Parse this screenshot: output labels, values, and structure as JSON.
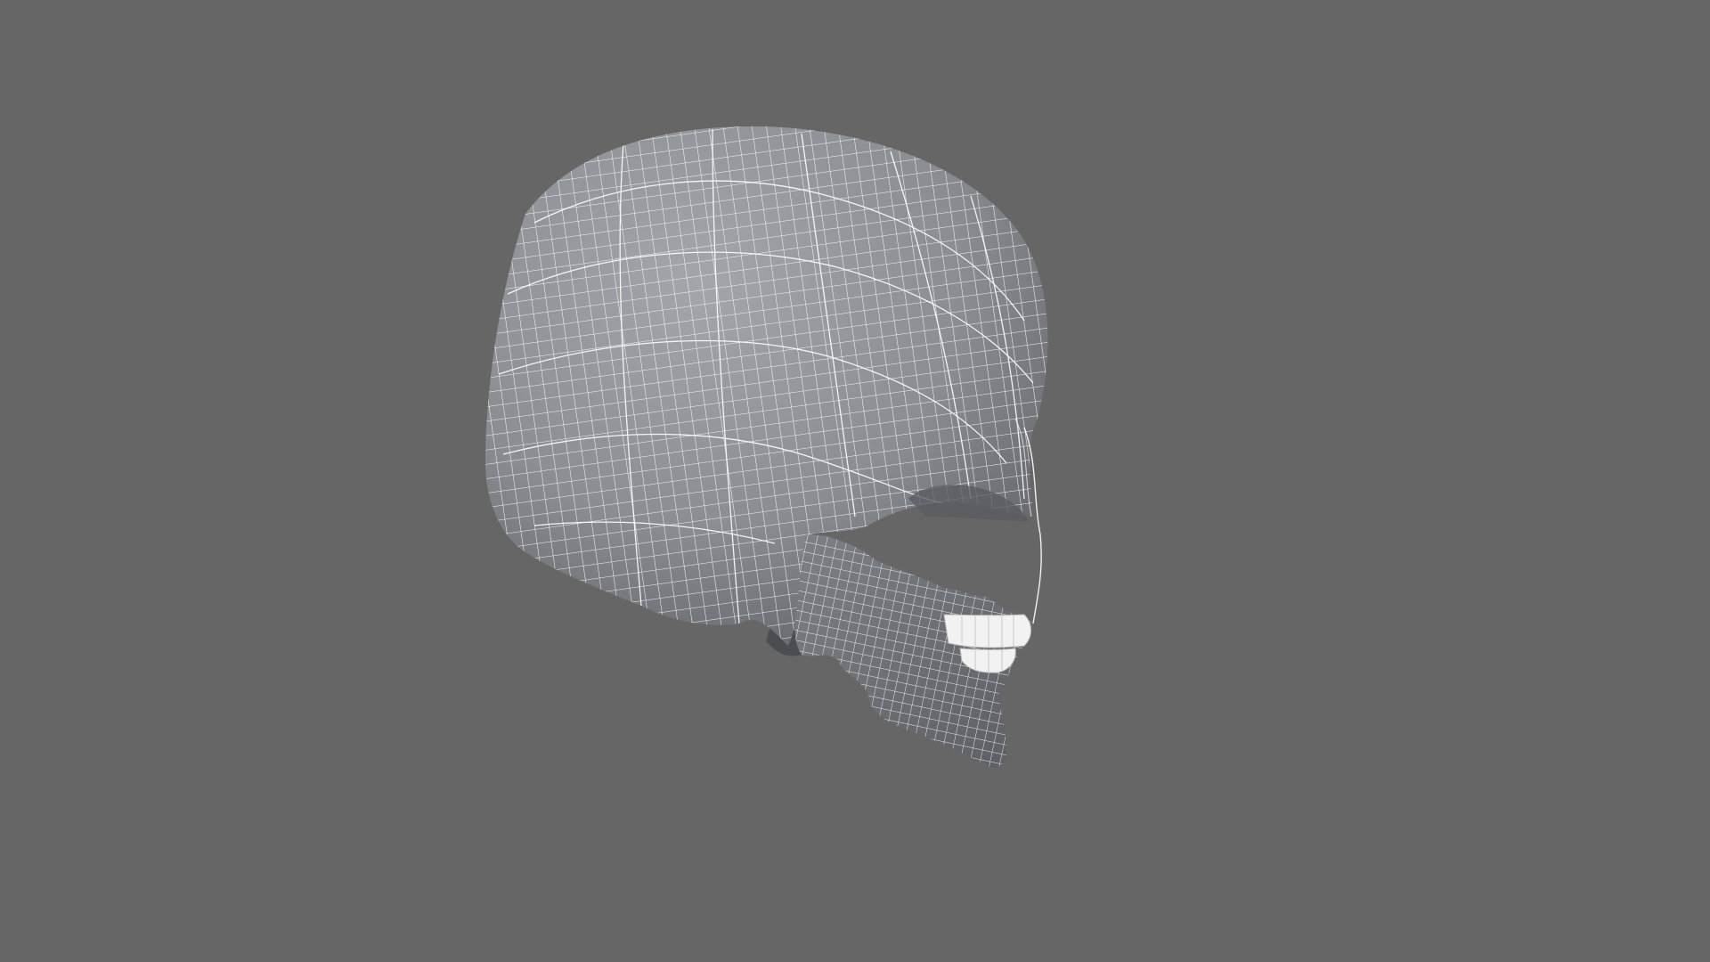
{
  "scene": {
    "subject": "skull-wireframe-side-view",
    "background_color": "#666666",
    "mesh_fill_color": "#8a8d91",
    "mesh_shadow_color": "#4f5256",
    "wire_color": "#ffffff",
    "teeth_color": "#f2f2f2"
  }
}
